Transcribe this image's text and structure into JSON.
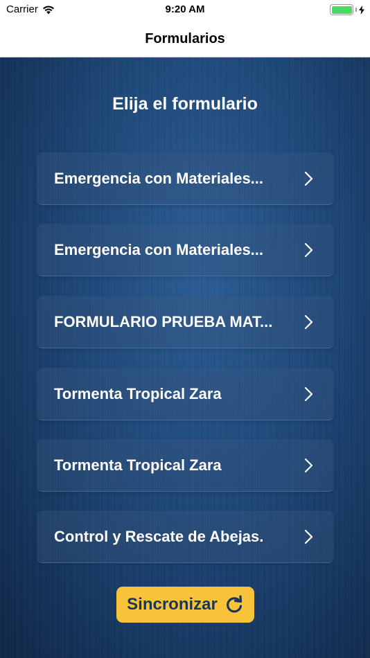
{
  "status_bar": {
    "carrier": "Carrier",
    "time": "9:20 AM",
    "battery_color": "#4cd964"
  },
  "nav": {
    "title": "Formularios"
  },
  "main": {
    "heading": "Elija el formulario",
    "forms": [
      {
        "label": "Emergencia con Materiales..."
      },
      {
        "label": "Emergencia con Materiales..."
      },
      {
        "label": "FORMULARIO PRUEBA MAT..."
      },
      {
        "label": "Tormenta Tropical Zara"
      },
      {
        "label": "Tormenta Tropical Zara"
      },
      {
        "label": "Control y Rescate de Abejas."
      }
    ],
    "sync_button": {
      "label": "Sincronizar",
      "icon": "refresh-icon",
      "color": "#f6c33a"
    }
  },
  "colors": {
    "background": "#1d4677",
    "accent": "#f6c33a",
    "text_on_accent": "#1b3556"
  }
}
